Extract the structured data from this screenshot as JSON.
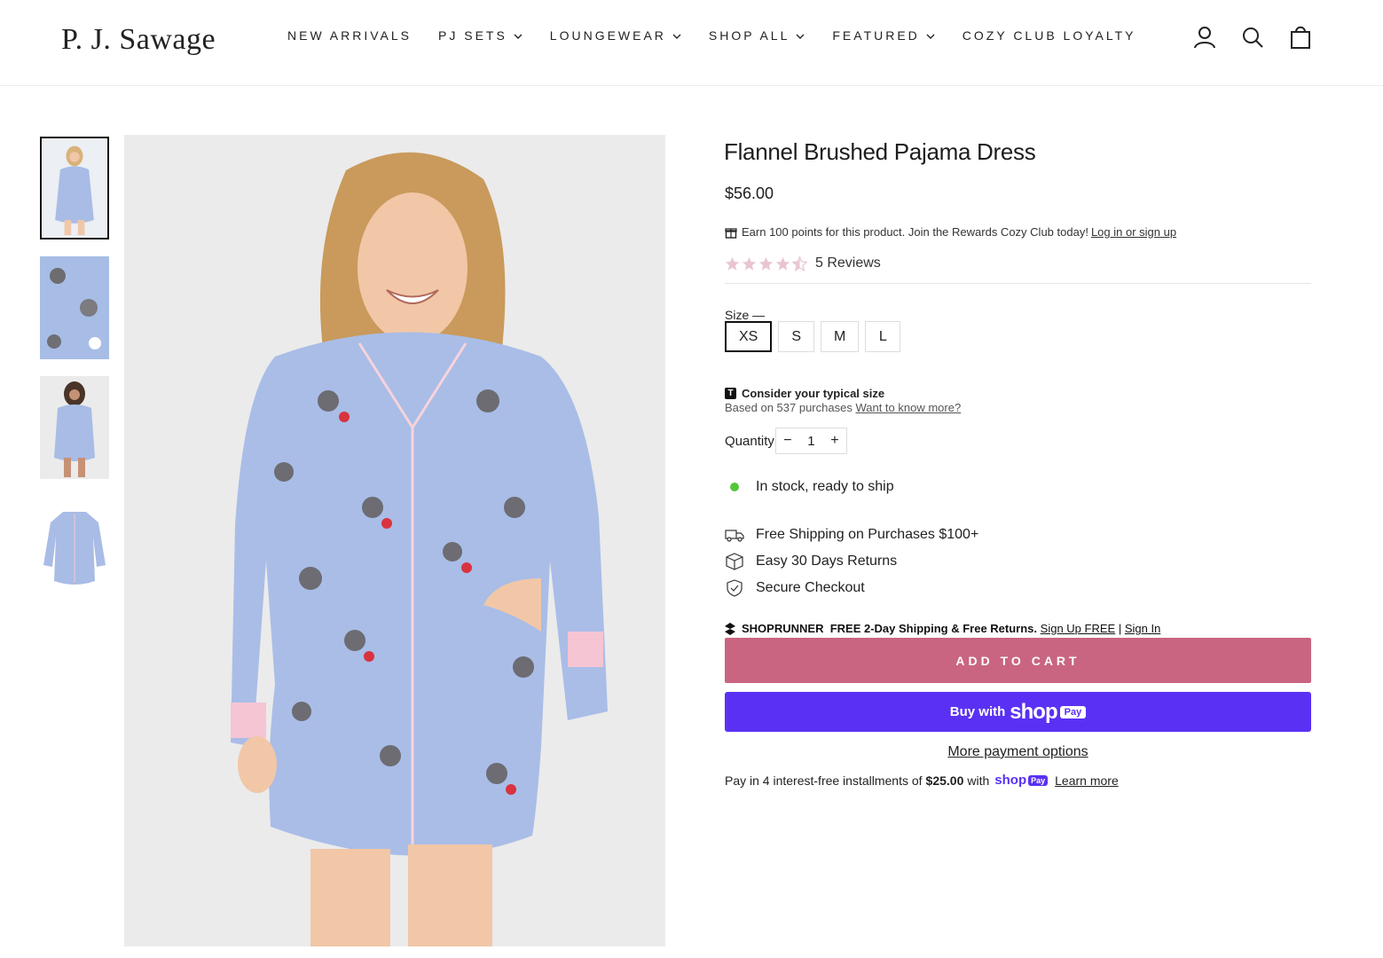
{
  "brand": {
    "logo_text": "P. J. Sawage"
  },
  "nav": {
    "items": [
      {
        "label": "NEW ARRIVALS",
        "has_dropdown": false
      },
      {
        "label": "PJ SETS",
        "has_dropdown": true
      },
      {
        "label": "LOUNGEWEAR",
        "has_dropdown": true
      },
      {
        "label": "SHOP ALL",
        "has_dropdown": true
      },
      {
        "label": "FEATURED",
        "has_dropdown": true
      },
      {
        "label": "COZY CLUB LOYALTY",
        "has_dropdown": false
      }
    ],
    "icons": [
      "account-icon",
      "search-icon",
      "cart-icon"
    ]
  },
  "gallery": {
    "thumbnails": [
      "model-front",
      "fabric-closeup",
      "model-alt",
      "flat-lay"
    ],
    "active_index": 0
  },
  "product": {
    "title": "Flannel Brushed Pajama Dress",
    "price": "$56.00",
    "rewards_text": "Earn 100 points for this product. Join the Rewards Cozy Club today!",
    "rewards_link": "Log in or sign up",
    "rating": 4.5,
    "reviews_label": "5 Reviews",
    "size_label": "Size",
    "size_dash": "—",
    "sizes": [
      "XS",
      "S",
      "M",
      "L"
    ],
    "selected_size": "XS",
    "fit_title": "Consider your typical size",
    "fit_subtitle": "Based on 537 purchases",
    "fit_link": "Want to know more?",
    "quantity_label": "Quantity",
    "quantity": "1",
    "qty_minus": "−",
    "qty_plus": "+",
    "stock_text": "In stock, ready to ship",
    "perks": [
      {
        "icon": "truck-icon",
        "label": "Free Shipping on Purchases $100+"
      },
      {
        "icon": "box-icon",
        "label": "Easy 30 Days Returns"
      },
      {
        "icon": "shield-icon",
        "label": "Secure Checkout"
      }
    ],
    "shoprunner": {
      "brand": "SHOPRUNNER",
      "offer": "FREE 2-Day Shipping & Free Returns.",
      "signup": "Sign Up FREE",
      "separator": "|",
      "signin": "Sign In"
    },
    "add_to_cart": "ADD TO CART",
    "shop_pay": {
      "buy_with": "Buy with",
      "shop": "shop",
      "pay": "Pay"
    },
    "more_payment": "More payment options",
    "installments": {
      "prefix": "Pay in 4 interest-free installments of",
      "amount": "$25.00",
      "with": "with",
      "shop": "shop",
      "pay": "Pay",
      "learn_more": "Learn more"
    }
  },
  "colors": {
    "accent": "#c96580",
    "shop_pay": "#5a31f4",
    "in_stock": "#54c63a",
    "star": "#e9c6cf"
  }
}
